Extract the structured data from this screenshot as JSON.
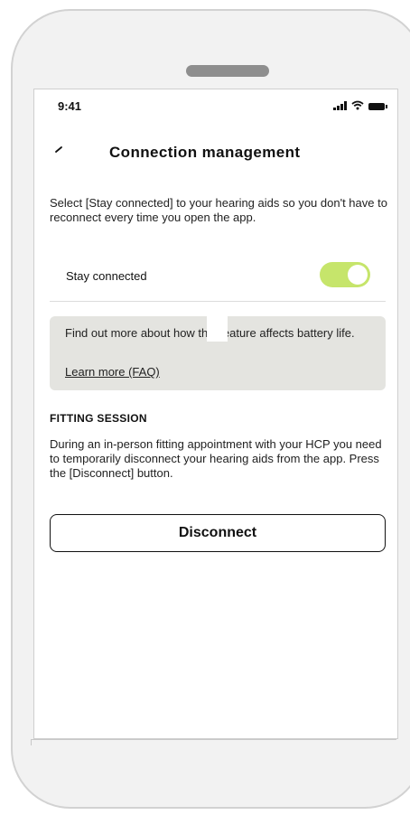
{
  "status_bar": {
    "time": "9:41",
    "icons": [
      "signal-icon",
      "wifi-icon",
      "battery-icon"
    ]
  },
  "header": {
    "back_icon": "chevron-left-icon",
    "title": "Connection management"
  },
  "intro": {
    "text": "Select [Stay connected] to your hearing aids so you don't have to reconnect every time you open the app."
  },
  "stay_connected": {
    "label": "Stay connected",
    "enabled": true
  },
  "info_box": {
    "text": "Find out more about how this feature affects battery life.",
    "link_label": "Learn more (FAQ)"
  },
  "fitting_session": {
    "heading": "FITTING SESSION",
    "text": "During an in-person fitting appointment with your HCP you need to temporarily disconnect your hearing aids from the app. Press the [Disconnect] button.",
    "button_label": "Disconnect"
  },
  "colors": {
    "toggle_on": "#c6e56b",
    "info_background": "#e4e4e0",
    "phone_frame": "#f2f2f2"
  }
}
